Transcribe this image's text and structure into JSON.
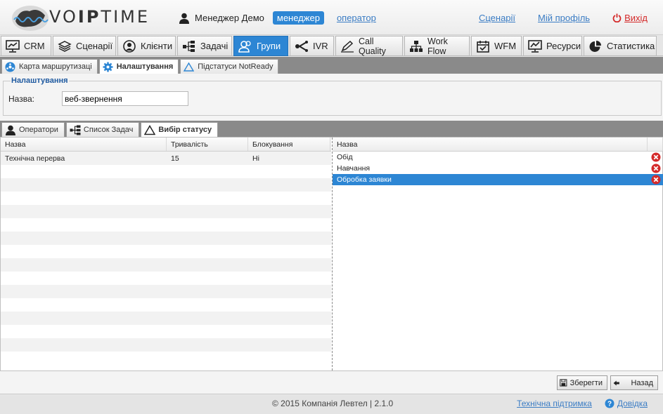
{
  "header": {
    "logo_text_prefix": "VO",
    "logo_text_bold": "IP",
    "logo_text_suffix": "TIME",
    "user_name": "Менеджер Демо",
    "role_active": "менеджер",
    "role_other": "оператор",
    "scenarios_link": "Сценарії",
    "profile_link": "Мій профіль",
    "logout_link": "Вихід"
  },
  "main_menu": [
    {
      "label": "CRM",
      "icon": "monitor-chart-icon"
    },
    {
      "label": "Сценарії",
      "icon": "layers-icon"
    },
    {
      "label": "Клієнти",
      "icon": "client-icon"
    },
    {
      "label": "Задачі",
      "icon": "tasks-tree-icon"
    },
    {
      "label": "Групи",
      "icon": "group-icon",
      "active": true
    },
    {
      "label": "IVR",
      "icon": "ivr-icon"
    },
    {
      "label": "Call Quality",
      "icon": "pen-icon"
    },
    {
      "label": "Work Flow",
      "icon": "hierarchy-icon"
    },
    {
      "label": "WFM",
      "icon": "calendar-icon"
    },
    {
      "label": "Ресурси",
      "icon": "resources-chart-icon"
    },
    {
      "label": "Статистика",
      "icon": "pie-chart-icon"
    }
  ],
  "sub_tabs": [
    {
      "label": "Карта маршрутизаці",
      "icon": "routing-map-icon"
    },
    {
      "label": "Налаштування",
      "icon": "gear-icon",
      "active": true
    },
    {
      "label": "Підстатуси NotReady",
      "icon": "triangle-icon"
    }
  ],
  "settings": {
    "legend": "Налаштування",
    "name_label": "Назва:",
    "name_value": "веб-звернення"
  },
  "inner_tabs": [
    {
      "label": "Оператори",
      "icon": "operator-icon"
    },
    {
      "label": "Список Задач",
      "icon": "task-list-icon"
    },
    {
      "label": "Вибір статусу",
      "icon": "triangle-icon",
      "active": true
    }
  ],
  "left_table": {
    "columns": [
      "Назва",
      "Тривалість",
      "Блокування"
    ],
    "rows": [
      [
        "Технічна перерва",
        "15",
        "Ні"
      ]
    ]
  },
  "right_table": {
    "columns": [
      "Назва"
    ],
    "rows": [
      {
        "name": "Обід",
        "selected": false
      },
      {
        "name": "Навчання",
        "selected": false
      },
      {
        "name": "Обробка заявки",
        "selected": true
      }
    ]
  },
  "buttons": {
    "save": "Зберегти",
    "back": "Назад"
  },
  "footer": {
    "copyright": "© 2015 Компанія Левтел | 2.1.0",
    "support_link": "Технічна підтримка",
    "help_link": "Довідка"
  },
  "colors": {
    "accent": "#2d86d4",
    "logout": "#d42a2a",
    "link": "#3a7cc4"
  }
}
